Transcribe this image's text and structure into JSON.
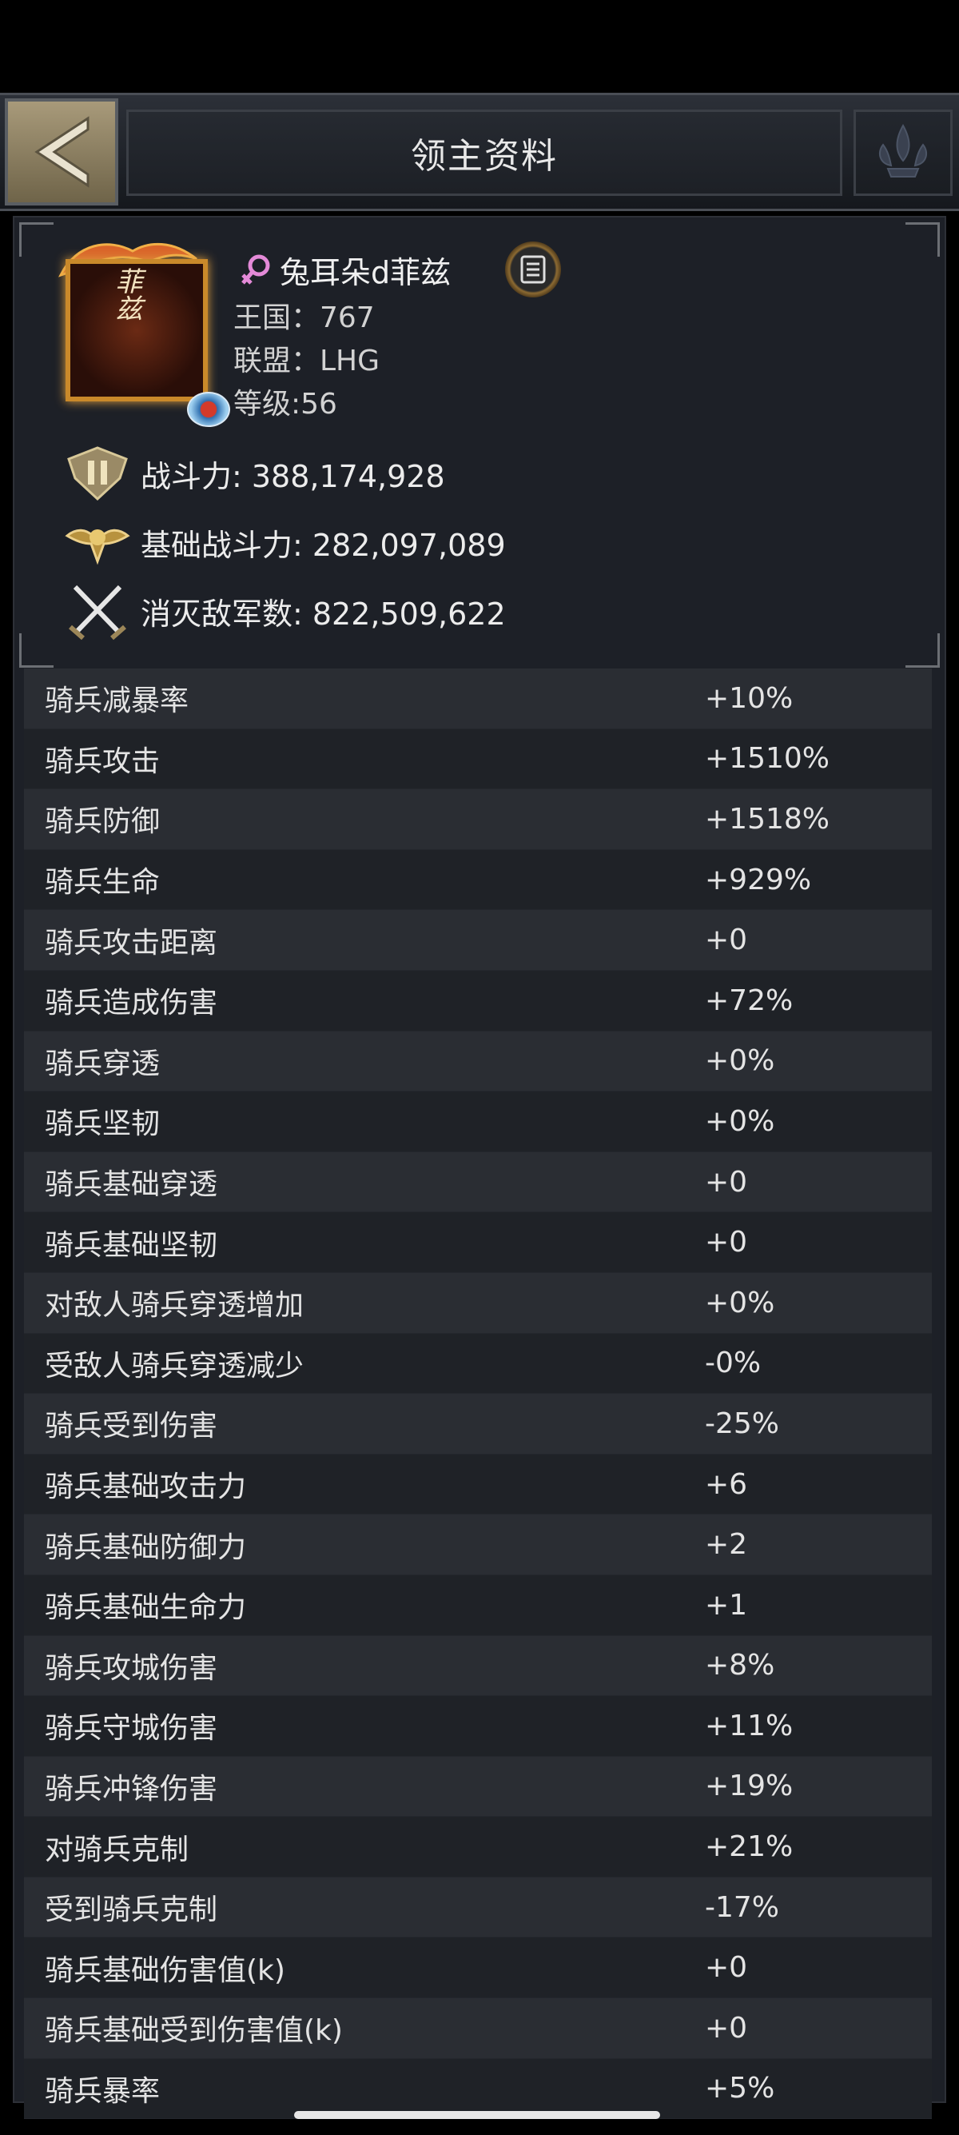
{
  "header": {
    "title": "领主资料",
    "back_icon": "chevron-left-icon",
    "emblem_icon": "fleur-emblem-icon"
  },
  "profile": {
    "name": "兔耳朵d菲兹",
    "gender_icon": "female-symbol-icon",
    "avatar_text": "菲兹",
    "kingdom": "王国：767",
    "alliance": "联盟：LHG",
    "level": "等级:56",
    "power": "战斗力: 388,174,928",
    "base_power": "基础战斗力: 282,097,089",
    "kills": "消灭敌军数: 822,509,622"
  },
  "attributes": [
    {
      "name": "骑兵减暴率",
      "value": "+10%"
    },
    {
      "name": "骑兵攻击",
      "value": "+1510%"
    },
    {
      "name": "骑兵防御",
      "value": "+1518%"
    },
    {
      "name": "骑兵生命",
      "value": "+929%"
    },
    {
      "name": "骑兵攻击距离",
      "value": "+0"
    },
    {
      "name": "骑兵造成伤害",
      "value": "+72%"
    },
    {
      "name": "骑兵穿透",
      "value": "+0%"
    },
    {
      "name": "骑兵坚韧",
      "value": "+0%"
    },
    {
      "name": "骑兵基础穿透",
      "value": "+0"
    },
    {
      "name": "骑兵基础坚韧",
      "value": "+0"
    },
    {
      "name": "对敌人骑兵穿透增加",
      "value": "+0%"
    },
    {
      "name": "受敌人骑兵穿透减少",
      "value": "-0%"
    },
    {
      "name": "骑兵受到伤害",
      "value": "-25%"
    },
    {
      "name": "骑兵基础攻击力",
      "value": "+6"
    },
    {
      "name": "骑兵基础防御力",
      "value": "+2"
    },
    {
      "name": "骑兵基础生命力",
      "value": "+1"
    },
    {
      "name": "骑兵攻城伤害",
      "value": "+8%"
    },
    {
      "name": "骑兵守城伤害",
      "value": "+11%"
    },
    {
      "name": "骑兵冲锋伤害",
      "value": "+19%"
    },
    {
      "name": "对骑兵克制",
      "value": "+21%"
    },
    {
      "name": "受到骑兵克制",
      "value": "-17%"
    },
    {
      "name": "骑兵基础伤害值(k)",
      "value": "+0"
    },
    {
      "name": "骑兵基础受到伤害值(k)",
      "value": "+0"
    },
    {
      "name": "骑兵暴率",
      "value": "+5%"
    }
  ]
}
